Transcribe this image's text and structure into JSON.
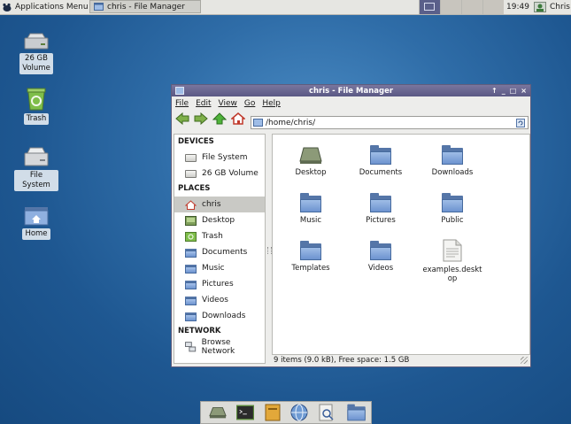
{
  "panel": {
    "app_menu_label": "Applications Menu",
    "task_label": "chris - File Manager",
    "clock": "19:49",
    "user": "Chris"
  },
  "desktop_icons": [
    {
      "label": "26 GB\nVolume",
      "icon": "drive-icon"
    },
    {
      "label": "Trash",
      "icon": "trash-icon"
    },
    {
      "label": "File System",
      "icon": "drive-icon"
    },
    {
      "label": "Home",
      "icon": "home-folder-icon"
    }
  ],
  "window": {
    "title": "chris - File Manager",
    "title_buttons": [
      "↑",
      "_",
      "□",
      "×"
    ],
    "menu": [
      "File",
      "Edit",
      "View",
      "Go",
      "Help"
    ],
    "path": "/home/chris/",
    "sidebar": {
      "devices_header": "DEVICES",
      "devices": [
        "File System",
        "26 GB Volume"
      ],
      "places_header": "PLACES",
      "places": [
        "chris",
        "Desktop",
        "Trash",
        "Documents",
        "Music",
        "Pictures",
        "Videos",
        "Downloads"
      ],
      "network_header": "NETWORK",
      "network": [
        "Browse Network"
      ],
      "selected": "chris"
    },
    "items": [
      {
        "label": "Desktop",
        "icon": "desktop-folder-icon"
      },
      {
        "label": "Documents",
        "icon": "folder-icon"
      },
      {
        "label": "Downloads",
        "icon": "folder-icon"
      },
      {
        "label": "Music",
        "icon": "folder-icon"
      },
      {
        "label": "Pictures",
        "icon": "folder-icon"
      },
      {
        "label": "Public",
        "icon": "folder-icon"
      },
      {
        "label": "Templates",
        "icon": "folder-icon"
      },
      {
        "label": "Videos",
        "icon": "folder-icon"
      },
      {
        "label": "examples.desktop",
        "icon": "text-file-icon"
      }
    ],
    "status": "9 items (9.0 kB), Free space: 1.5 GB"
  },
  "dock": [
    "show-desktop-icon",
    "terminal-icon",
    "file-manager-icon",
    "web-browser-icon",
    "search-icon",
    "folder-icon"
  ]
}
